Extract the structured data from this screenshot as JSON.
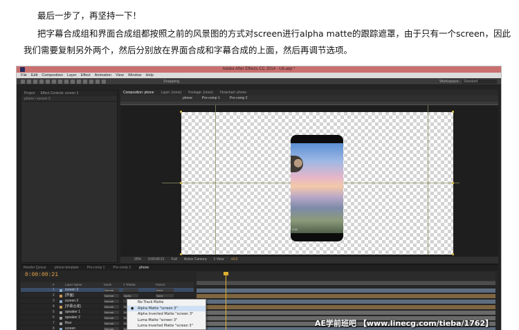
{
  "article": {
    "paragraph_1": "最后一步了，再坚持一下！",
    "paragraph_2": "把字幕合成组和界面合成组都按照之前的风景图的方式对screen进行alpha matte的跟踪遮罩，由于只有一个screen，因此我们需要复制另外两个，然后分别放在界面合成和字幕合成的上面，然后再调节选项。"
  },
  "window": {
    "title": "Adobe After Effects CC 2014 - U6.aep *"
  },
  "menu": [
    "File",
    "Edit",
    "Composition",
    "Layer",
    "Effect",
    "Animation",
    "View",
    "Window",
    "Help"
  ],
  "toolbar": {
    "snapping": "Snapping",
    "workspace_label": "Workspace:",
    "workspace_value": "Standard"
  },
  "left_panel": {
    "tabs": [
      "Project",
      "Effect Controls: screen 3"
    ],
    "subtitle": "phone • screen 3"
  },
  "viewer": {
    "tabs": [
      "Composition: phone",
      "Layer: (none)",
      "Footage: (none)",
      "Flowchart: phone"
    ],
    "crumbs": [
      "phone",
      "Pre-comp 1",
      "Pre-comp 2"
    ],
    "phone_time": "9:58",
    "footer": {
      "zoom": "25%",
      "timecode": "0:00:00:21",
      "resolution": "Full",
      "camera": "Active Camera",
      "views": "1 View",
      "offset": "+0.0"
    },
    "accent": "#e0b030"
  },
  "timeline": {
    "tabs": [
      "Render Queue",
      "phone-template",
      "Pre-comp 1",
      "Pre-comp 2",
      "phone"
    ],
    "timecode": "0:00:00:21",
    "columns": [
      "#",
      "Layer Name",
      "Mode",
      "T TrkMat",
      "Parent"
    ],
    "layers": [
      {
        "num": "1",
        "name": "screen 3",
        "mode": "Normal",
        "trkmat": "",
        "parent": "None",
        "color": "#8aa8c8",
        "selected": true
      },
      {
        "num": "2",
        "name": "[界面]",
        "mode": "Normal",
        "trkmat": "Alpha",
        "parent": "None",
        "color": "#c89a5a",
        "selected": false
      },
      {
        "num": "3",
        "name": "screen 2",
        "mode": "Normal",
        "trkmat": "",
        "parent": "None",
        "color": "#8aa8c8",
        "selected": false
      },
      {
        "num": "4",
        "name": "[字幕合成]",
        "mode": "Normal",
        "trkmat": "None",
        "parent": "None",
        "color": "#c89a5a",
        "selected": false
      },
      {
        "num": "5",
        "name": "speaker 1",
        "mode": "Normal",
        "trkmat": "None",
        "parent": "None",
        "color": "#a0a0a0",
        "selected": false
      },
      {
        "num": "6",
        "name": "speaker 2",
        "mode": "Normal",
        "trkmat": "None",
        "parent": "None",
        "color": "#a0a0a0",
        "selected": false
      },
      {
        "num": "7",
        "name": "floor",
        "mode": "Normal",
        "trkmat": "None",
        "parent": "None",
        "color": "#a0a0a0",
        "selected": false
      },
      {
        "num": "8",
        "name": "screen",
        "mode": "Normal",
        "trkmat": "None",
        "parent": "None",
        "color": "#8aa8c8",
        "selected": false
      }
    ]
  },
  "trkmat_dropdown": {
    "items": [
      {
        "label": "No Track Matte",
        "checked": false
      },
      {
        "label": "Alpha Matte \"screen 3\"",
        "checked": true
      },
      {
        "label": "Alpha Inverted Matte \"screen 3\"",
        "checked": false
      },
      {
        "label": "Luma Matte \"screen 3\"",
        "checked": false
      },
      {
        "label": "Luma Inverted Matte \"screen 3\"",
        "checked": false
      }
    ]
  },
  "watermark": "AE学前班吧 【www.linecg.com/tieba/1762】"
}
